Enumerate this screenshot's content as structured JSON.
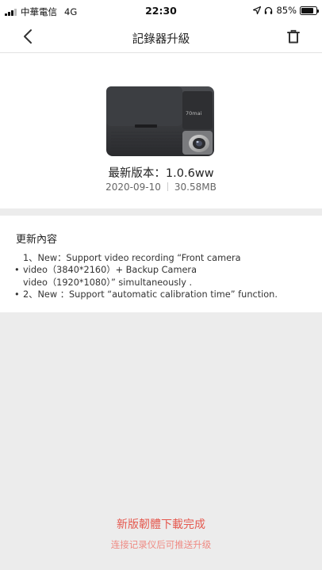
{
  "status_bar": {
    "carrier": "中華電信",
    "network": "4G",
    "time": "22:30",
    "battery": "85%",
    "battery_level": 0.85
  },
  "nav": {
    "title": "記錄器升級"
  },
  "firmware": {
    "version_label": "最新版本：1.0.6ww",
    "date": "2020-09-10",
    "size": "30.58MB",
    "device_brand": "70mai"
  },
  "notes": {
    "title": "更新內容",
    "lines": [
      {
        "bullet": "",
        "text": "1、New：Support video recording “Front camera"
      },
      {
        "bullet": "•",
        "text": "video（3840*2160）+ Backup Camera"
      },
      {
        "bullet": "",
        "text": "video（1920*1080）” simultaneously ."
      },
      {
        "bullet": "•",
        "text": "2、New ：Support “automatic calibration time” function."
      }
    ]
  },
  "footer": {
    "status": "新版韌體下載完成",
    "hint": "连接记录仪后可推送升级"
  },
  "colors": {
    "accent_red": "#e5594f",
    "hint_red": "#ef8a83",
    "background": "#ececec"
  },
  "icons": {
    "back": "chevron-left-icon",
    "delete": "trash-icon",
    "location": "location-arrow-icon",
    "headphones": "headphones-icon"
  }
}
